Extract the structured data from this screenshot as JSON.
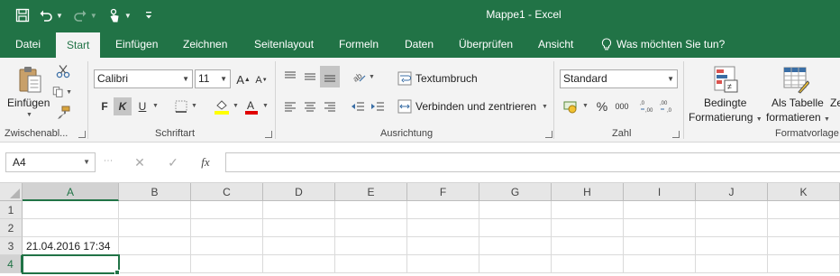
{
  "window": {
    "title": "Mappe1 - Excel"
  },
  "qat": {
    "save_icon": "save-icon",
    "undo_icon": "undo-icon",
    "redo_icon": "redo-icon",
    "touch_icon": "touch-mode-icon",
    "customize_icon": "customize-qat-icon"
  },
  "tabs": [
    {
      "label": "Datei"
    },
    {
      "label": "Start"
    },
    {
      "label": "Einfügen"
    },
    {
      "label": "Zeichnen"
    },
    {
      "label": "Seitenlayout"
    },
    {
      "label": "Formeln"
    },
    {
      "label": "Daten"
    },
    {
      "label": "Überprüfen"
    },
    {
      "label": "Ansicht"
    }
  ],
  "tellme": {
    "label": "Was möchten Sie tun?"
  },
  "ribbon": {
    "clipboard": {
      "paste_label": "Einfügen",
      "group_label": "Zwischenabl..."
    },
    "font": {
      "font_name": "Calibri",
      "font_size": "11",
      "bold": "F",
      "italic": "K",
      "underline": "U",
      "group_label": "Schriftart"
    },
    "alignment": {
      "wrap_label": "Textumbruch",
      "merge_label": "Verbinden und zentrieren",
      "group_label": "Ausrichtung"
    },
    "number": {
      "format": "Standard",
      "percent": "%",
      "thousands": "000",
      "group_label": "Zahl"
    },
    "styles": {
      "conditional_line1": "Bedingte",
      "conditional_line2": "Formatierung",
      "table_line1": "Als Tabelle",
      "table_line2": "formatieren",
      "group_label": "Formatvorlage",
      "cut_off": "Ze"
    }
  },
  "formula_bar": {
    "name_box": "A4",
    "fx": "fx",
    "value": ""
  },
  "sheet": {
    "columns": [
      "A",
      "B",
      "C",
      "D",
      "E",
      "F",
      "G",
      "H",
      "I",
      "J",
      "K"
    ],
    "rows": [
      "1",
      "2",
      "3",
      "4"
    ],
    "cells": {
      "A3": "21.04.2016 17:34"
    },
    "active_cell": "A4"
  },
  "colors": {
    "accent": "#217346",
    "ribbon_bg": "#f3f3f3"
  }
}
